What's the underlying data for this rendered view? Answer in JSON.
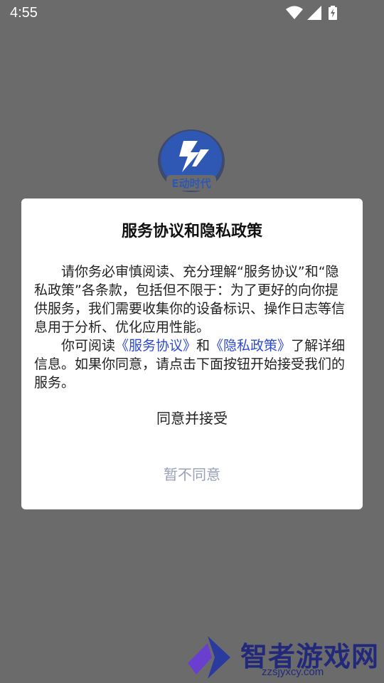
{
  "status_bar": {
    "time": "4:55",
    "icons": [
      "wifi-icon",
      "cellular-signal-icon",
      "battery-charging-icon"
    ]
  },
  "splash": {
    "logo_text": "E动时代"
  },
  "dialog": {
    "title": "服务协议和隐私政策",
    "paragraph1": "请你务必审慎阅读、充分理解“服务协议”和“隐私政策”各条款，包括但不限于：为了更好的向你提供服务，我们需要收集你的设备标识、操作日志等信息用于分析、优化应用性能。",
    "paragraph2_prefix": "你可阅读",
    "service_agreement_link": "《服务协议》",
    "paragraph2_and": "和",
    "privacy_policy_link": "《隐私政策》",
    "paragraph2_suffix": "了解详细信息。如果你同意，请点击下面按钮开始接受我们的服务。",
    "agree_label": "同意并接受",
    "decline_label": "暂不同意"
  },
  "watermark": {
    "text": "智者游戏网",
    "subtext": "zzsjyxcy.com"
  },
  "colors": {
    "overlay": "#6b6b6b",
    "dialog_bg": "#ffffff",
    "link": "#2d4ad6",
    "decline_text": "#9aa0b8"
  }
}
